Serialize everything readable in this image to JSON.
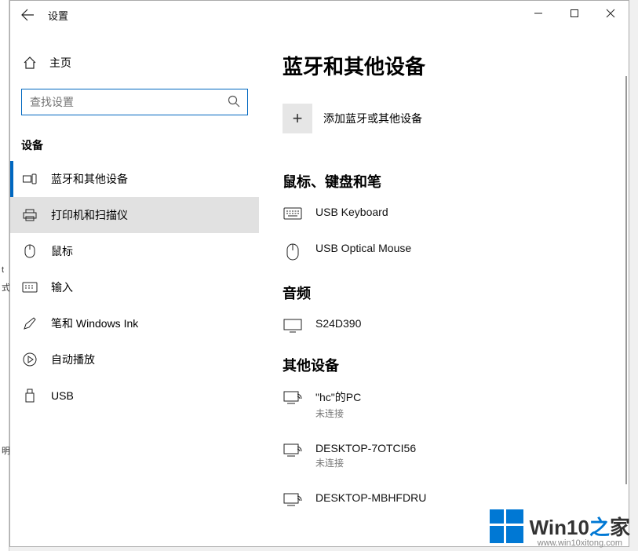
{
  "titlebar": {
    "title": "设置"
  },
  "sidebar": {
    "home": "主页",
    "searchPlaceholder": "查找设置",
    "sectionHeader": "设备",
    "items": [
      {
        "label": "蓝牙和其他设备"
      },
      {
        "label": "打印机和扫描仪"
      },
      {
        "label": "鼠标"
      },
      {
        "label": "输入"
      },
      {
        "label": "笔和 Windows Ink"
      },
      {
        "label": "自动播放"
      },
      {
        "label": "USB"
      }
    ]
  },
  "main": {
    "heading": "蓝牙和其他设备",
    "addLabel": "添加蓝牙或其他设备",
    "groups": [
      {
        "title": "鼠标、键盘和笔",
        "devices": [
          {
            "name": "USB Keyboard",
            "sub": ""
          },
          {
            "name": "USB Optical Mouse",
            "sub": ""
          }
        ]
      },
      {
        "title": "音频",
        "devices": [
          {
            "name": "S24D390",
            "sub": ""
          }
        ]
      },
      {
        "title": "其他设备",
        "devices": [
          {
            "name": "\"hc\"的PC",
            "sub": "未连接"
          },
          {
            "name": "DESKTOP-7OTCI56",
            "sub": "未连接"
          },
          {
            "name": "DESKTOP-MBHFDRU",
            "sub": ""
          }
        ]
      }
    ]
  },
  "watermark": {
    "brand1": "Win10",
    "brand2": "之",
    "brand3": "家",
    "url": "www.win10xitong.com"
  },
  "edgeLabels": [
    "t",
    "式",
    "明"
  ]
}
